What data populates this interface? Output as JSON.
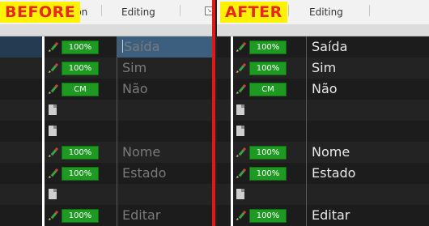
{
  "before": {
    "badge": "BEFORE",
    "tab_fragment": "ion",
    "tab_editing": "Editing",
    "rows": [
      {
        "type": "edit",
        "pct": "100%",
        "label": "Saída",
        "selected": true,
        "shade": false,
        "cursor": true
      },
      {
        "type": "edit",
        "pct": "100%",
        "label": "Sim",
        "selected": false,
        "shade": true
      },
      {
        "type": "edit",
        "pct": "CM",
        "label": "Não",
        "selected": false,
        "shade": false
      },
      {
        "type": "doc",
        "label": "",
        "selected": false,
        "shade": true
      },
      {
        "type": "doc",
        "label": "",
        "selected": false,
        "shade": false
      },
      {
        "type": "edit",
        "pct": "100%",
        "label": "Nome",
        "selected": false,
        "shade": true
      },
      {
        "type": "edit",
        "pct": "100%",
        "label": "Estado",
        "selected": false,
        "shade": false
      },
      {
        "type": "doc",
        "label": "",
        "selected": false,
        "shade": true
      },
      {
        "type": "edit",
        "pct": "100%",
        "label": "Editar",
        "selected": false,
        "shade": false
      }
    ]
  },
  "after": {
    "badge": "AFTER",
    "tab_editing": "Editing",
    "rows": [
      {
        "type": "edit",
        "pct": "100%",
        "label": "Saída",
        "selected": false,
        "shade": false
      },
      {
        "type": "edit",
        "pct": "100%",
        "label": "Sim",
        "selected": false,
        "shade": true
      },
      {
        "type": "edit",
        "pct": "CM",
        "label": "Não",
        "selected": false,
        "shade": false
      },
      {
        "type": "doc",
        "label": "",
        "selected": false,
        "shade": true
      },
      {
        "type": "doc",
        "label": "",
        "selected": false,
        "shade": false
      },
      {
        "type": "edit",
        "pct": "100%",
        "label": "Nome",
        "selected": false,
        "shade": true
      },
      {
        "type": "edit",
        "pct": "100%",
        "label": "Estado",
        "selected": false,
        "shade": false
      },
      {
        "type": "doc",
        "label": "",
        "selected": false,
        "shade": true
      },
      {
        "type": "edit",
        "pct": "100%",
        "label": "Editar",
        "selected": false,
        "shade": false
      }
    ]
  },
  "colors": {
    "badge_bg": "#fff200",
    "badge_text": "#e8281e",
    "divider": "#e01818",
    "pct_green": "#1e9a22",
    "selection": "#3c5f80"
  }
}
